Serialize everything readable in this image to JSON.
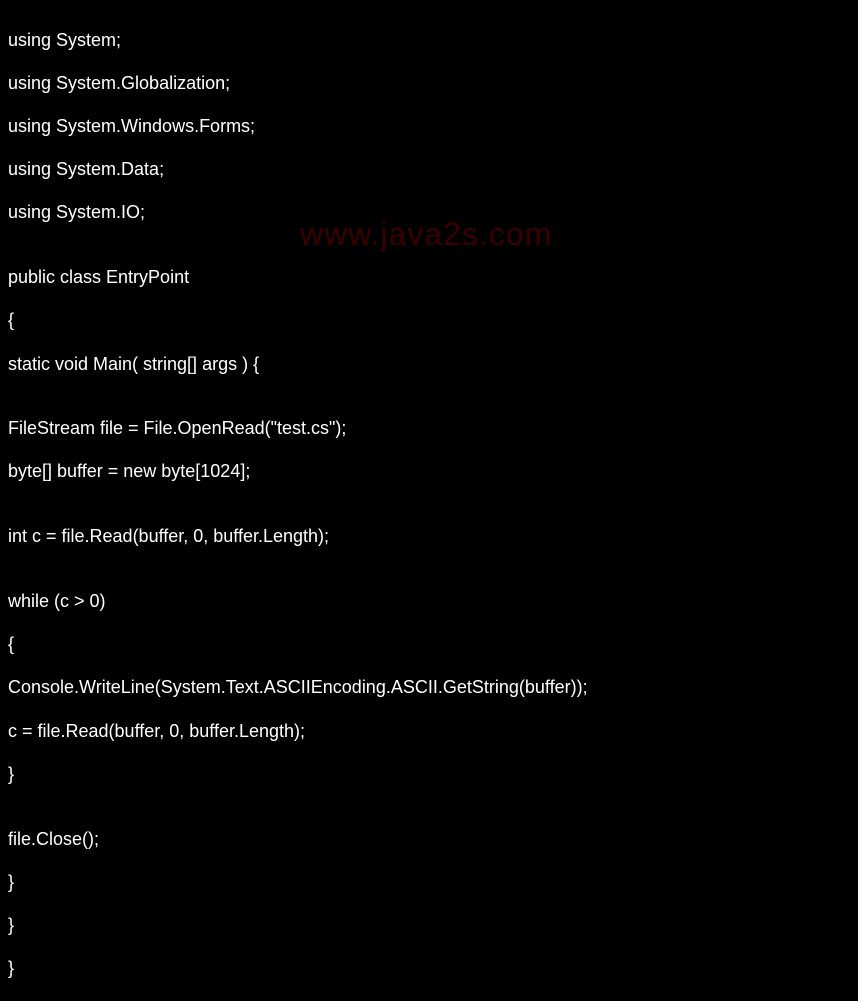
{
  "watermark": "www.java2s.com",
  "code": {
    "line1": "using System;",
    "line2": "using System.Globalization;",
    "line3": "using System.Windows.Forms;",
    "line4": "using System.Data;",
    "line5": "using System.IO;",
    "line6": "",
    "line7": "public class EntryPoint",
    "line8": "{",
    "line9": "static void Main( string[] args ) {",
    "line10": "",
    "line11": "FileStream file = File.OpenRead(\"test.cs\");",
    "line12": "byte[] buffer = new byte[1024];",
    "line13": "",
    "line14": "int c = file.Read(buffer, 0, buffer.Length);",
    "line15": "",
    "line16": "while (c > 0)",
    "line17": "{",
    "line18": "Console.WriteLine(System.Text.ASCIIEncoding.ASCII.GetString(buffer));",
    "line19": "c = file.Read(buffer, 0, buffer.Length);",
    "line20": "}",
    "line21": "",
    "line22": "file.Close();",
    "line23": "}",
    "line24": "}",
    "line25": "}"
  }
}
